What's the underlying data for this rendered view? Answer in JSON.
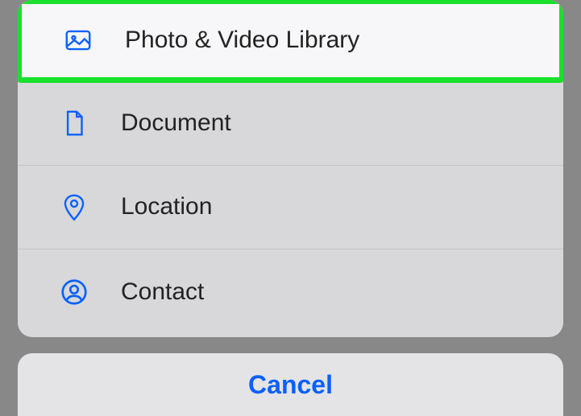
{
  "menu": {
    "items": [
      {
        "label": "Photo & Video Library",
        "icon": "photo-icon",
        "highlighted": true
      },
      {
        "label": "Document",
        "icon": "document-icon",
        "highlighted": false
      },
      {
        "label": "Location",
        "icon": "location-icon",
        "highlighted": false
      },
      {
        "label": "Contact",
        "icon": "contact-icon",
        "highlighted": false
      }
    ]
  },
  "cancel": {
    "label": "Cancel"
  },
  "colors": {
    "accent": "#0a60ff",
    "highlight_border": "#19e02a"
  }
}
